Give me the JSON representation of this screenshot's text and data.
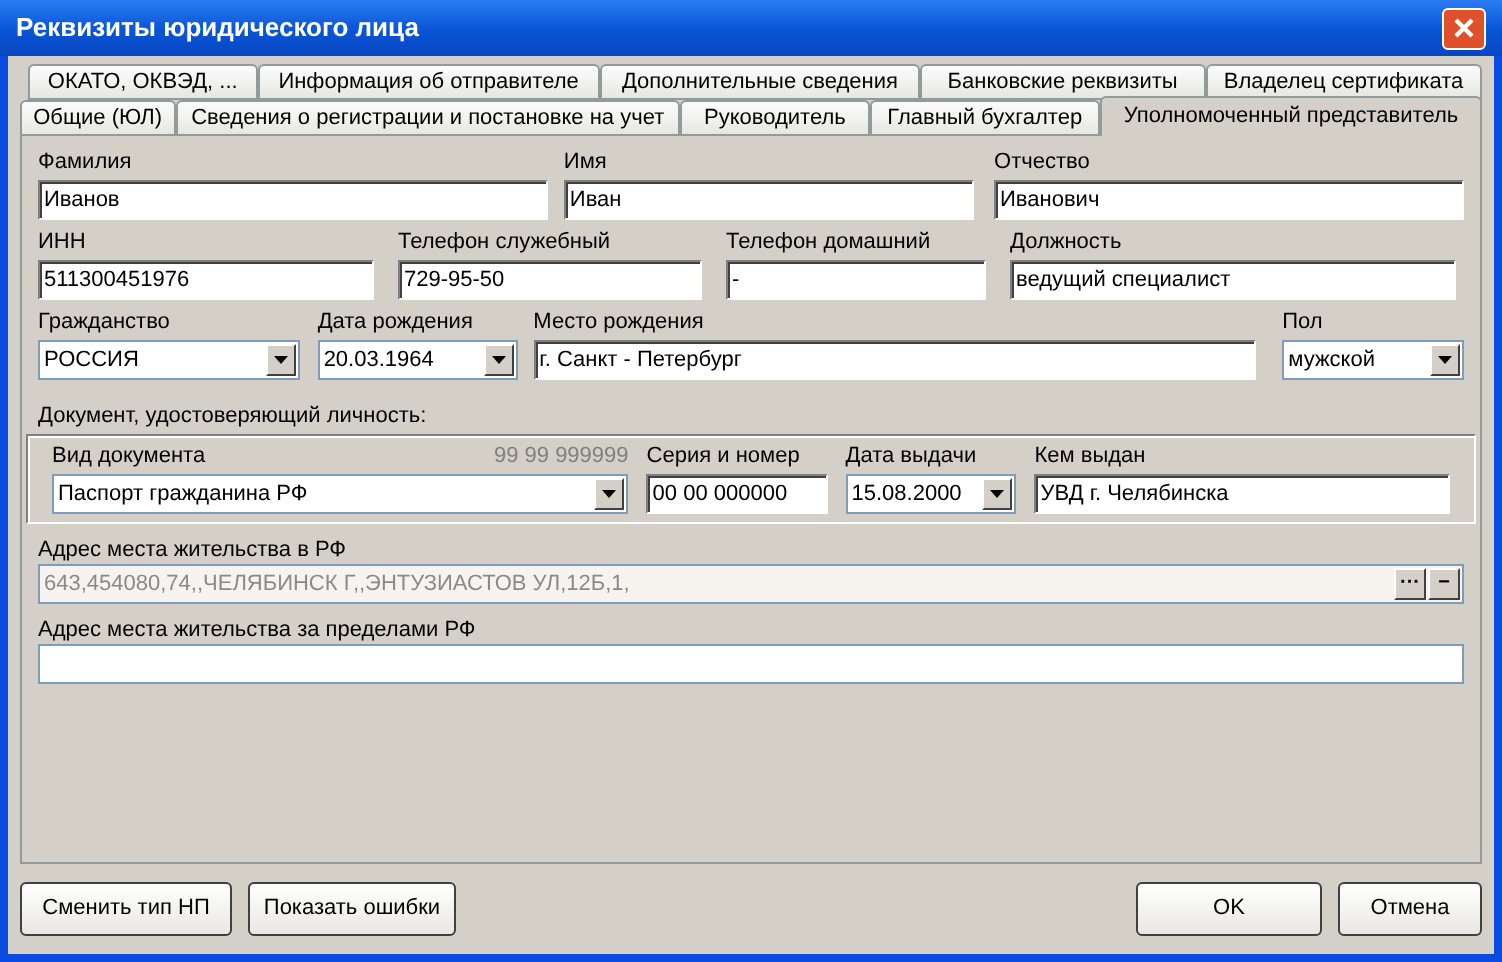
{
  "window": {
    "title": "Реквизиты юридического лица"
  },
  "tab_rows": [
    [
      {
        "label": "ОКАТО, ОКВЭД, ...",
        "selected": false
      },
      {
        "label": "Информация об отправителе",
        "selected": false
      },
      {
        "label": "Дополнительные сведения",
        "selected": false
      },
      {
        "label": "Банковские реквизиты",
        "selected": false
      },
      {
        "label": "Владелец сертификата",
        "selected": false
      }
    ],
    [
      {
        "label": "Общие (ЮЛ)",
        "selected": false
      },
      {
        "label": "Сведения о регистрации и постановке на учет",
        "selected": false
      },
      {
        "label": "Руководитель",
        "selected": false
      },
      {
        "label": "Главный бухгалтер",
        "selected": false
      },
      {
        "label": "Уполномоченный представитель",
        "selected": true
      }
    ]
  ],
  "rows": [
    [
      {
        "label": "Фамилия",
        "value": "Иванов",
        "kind": "text"
      },
      {
        "label": "Имя",
        "value": "Иван",
        "kind": "text"
      },
      {
        "label": "Отчество",
        "value": "Иванович",
        "kind": "text"
      }
    ],
    [
      {
        "label": "ИНН",
        "value": "511300451976",
        "kind": "text"
      },
      {
        "label": "Телефон служебный",
        "value": "729-95-50",
        "kind": "text"
      },
      {
        "label": "Телефон домашний",
        "value": "-",
        "kind": "text"
      },
      {
        "label": "Должность",
        "value": "ведущий специалист",
        "kind": "text"
      }
    ],
    [
      {
        "label": "Гражданство",
        "value": "РОССИЯ",
        "kind": "select"
      },
      {
        "label": "Дата рождения",
        "value": "20.03.1964",
        "kind": "select"
      },
      {
        "label": "Место рождения",
        "value": "г. Санкт - Петербург",
        "kind": "text"
      },
      {
        "label": "Пол",
        "value": "мужской",
        "kind": "select"
      }
    ]
  ],
  "document": {
    "title": "Документ, удостоверяющий личность:",
    "fields": [
      {
        "label": "Вид документа",
        "hint": "99 99 999999",
        "value": "Паспорт гражданина РФ",
        "kind": "select"
      },
      {
        "label": "Серия и номер",
        "value": "00 00 000000",
        "kind": "text"
      },
      {
        "label": "Дата выдачи",
        "value": "15.08.2000",
        "kind": "select"
      },
      {
        "label": "Кем выдан",
        "value": "УВД г. Челябинска",
        "kind": "text"
      }
    ]
  },
  "address": {
    "label": "Адрес места жительства в РФ",
    "value": "643,454080,74,,ЧЕЛЯБИНСК Г,,ЭНТУЗИАСТОВ УЛ,12Б,1,",
    "disabled": true,
    "buttons": [
      "···",
      "−"
    ]
  },
  "foreign_address": {
    "label": "Адрес места жительства за пределами РФ"
  },
  "buttons_left": [
    "Сменить тип НП",
    "Показать ошибки"
  ],
  "buttons_right": [
    "OK",
    "Отмена"
  ]
}
